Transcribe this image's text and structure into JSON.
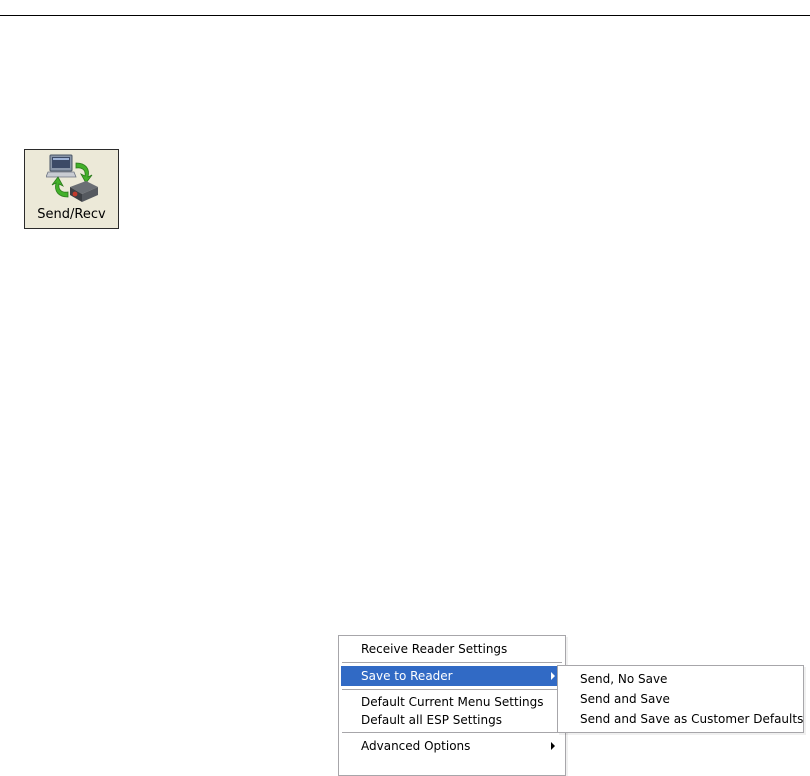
{
  "toolbar": {
    "send_recv_label": "Send/Recv",
    "send_recv_icon": "computer-reader-sync-icon"
  },
  "context_menu": {
    "items": [
      {
        "label": "Receive Reader Settings"
      },
      {
        "label": "Save to Reader",
        "highlighted": true,
        "has_submenu": true
      },
      {
        "label": "Default Current Menu Settings"
      },
      {
        "label": "Default all ESP Settings"
      },
      {
        "label": "Advanced Options",
        "has_submenu": true
      }
    ],
    "highlight_color": "#316ac5"
  },
  "save_submenu": {
    "items": [
      {
        "label": "Send, No Save"
      },
      {
        "label": "Send and Save"
      },
      {
        "label": "Send and Save as Customer Defaults"
      }
    ]
  }
}
